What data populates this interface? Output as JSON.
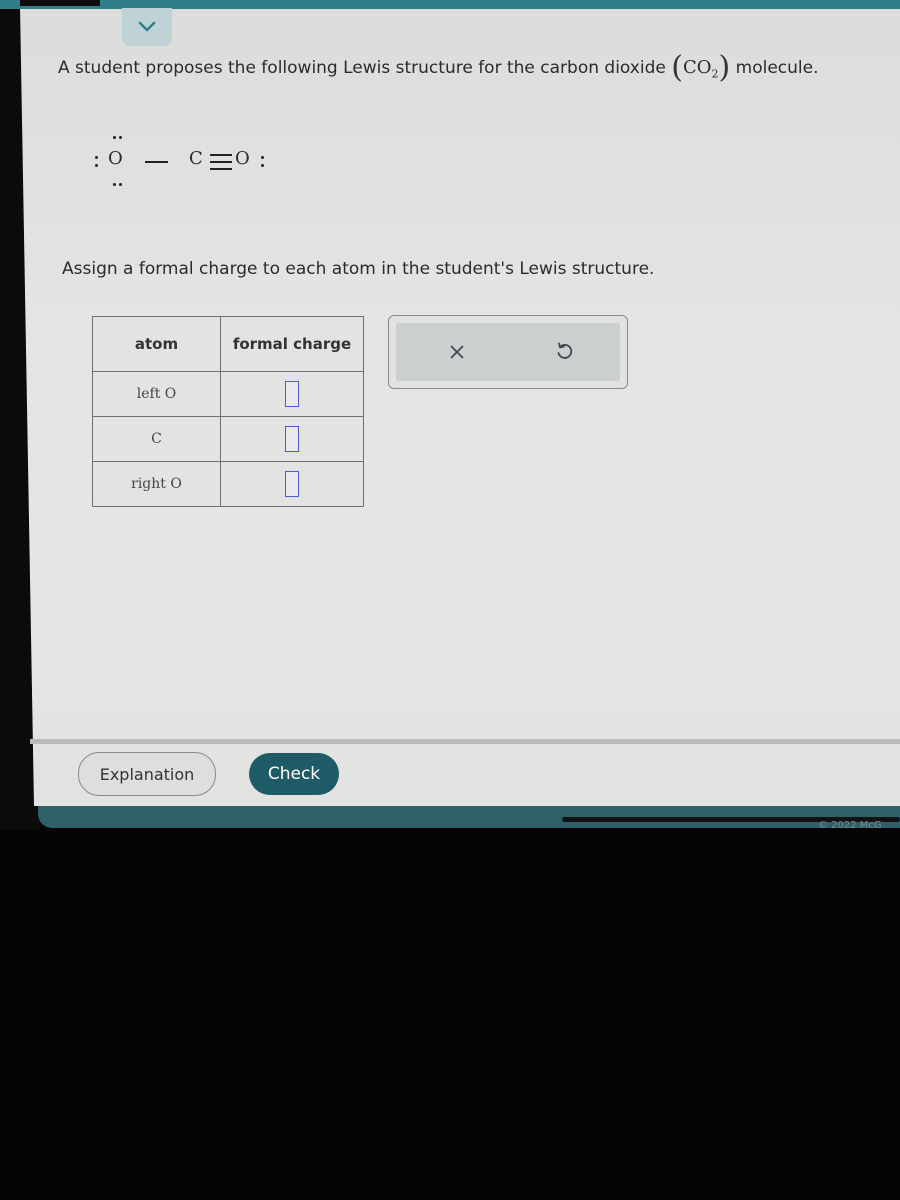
{
  "header": {
    "collapse_icon": "chevron-down-icon"
  },
  "question": {
    "prompt_before": "A student proposes the following Lewis structure for the carbon dioxide",
    "formula_open": "(",
    "formula_element_1": "C",
    "formula_element_2": "O",
    "formula_subscript": "2",
    "formula_close": ")",
    "prompt_after": "molecule.",
    "lewis_structure": {
      "left_atom": "O",
      "center_atom": "C",
      "right_atom": "O",
      "left_bond": "single",
      "right_bond": "triple"
    },
    "instruction": "Assign a formal charge to each atom in the student's Lewis structure."
  },
  "table": {
    "headers": [
      "atom",
      "formal charge"
    ],
    "rows": [
      {
        "atom": "left O",
        "formal_charge": ""
      },
      {
        "atom": "C",
        "formal_charge": ""
      },
      {
        "atom": "right O",
        "formal_charge": ""
      }
    ]
  },
  "tools": {
    "clear_icon": "close-icon",
    "undo_icon": "undo-icon"
  },
  "footer": {
    "explanation_label": "Explanation",
    "check_label": "Check",
    "copyright": "© 2022 McG"
  }
}
